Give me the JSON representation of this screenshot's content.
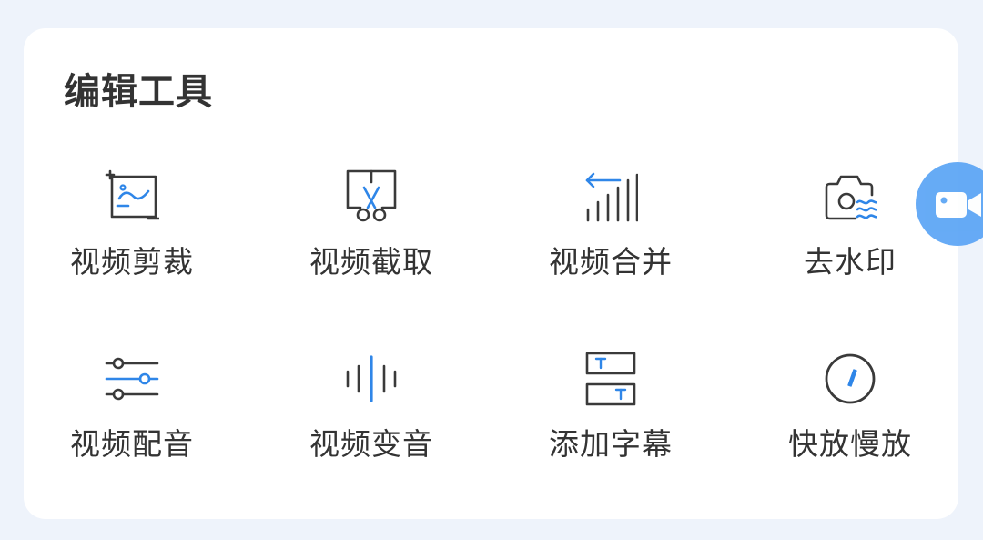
{
  "card": {
    "title": "编辑工具"
  },
  "tools": [
    {
      "label": "视频剪裁",
      "icon": "crop-image-icon"
    },
    {
      "label": "视频截取",
      "icon": "video-cut-scissors-icon"
    },
    {
      "label": "视频合并",
      "icon": "merge-bars-icon"
    },
    {
      "label": "去水印",
      "icon": "camera-watermark-icon"
    },
    {
      "label": "视频配音",
      "icon": "sliders-icon"
    },
    {
      "label": "视频变音",
      "icon": "voice-wave-icon"
    },
    {
      "label": "添加字幕",
      "icon": "subtitle-icon"
    },
    {
      "label": "快放慢放",
      "icon": "speed-dial-icon"
    }
  ],
  "floating_button": {
    "icon": "video-camera-icon"
  },
  "colors": {
    "accent": "#2f86e8",
    "icon_stroke": "#3a3a3a",
    "text": "#333333",
    "background": "#eef3fb",
    "card": "#ffffff",
    "floating_button": "#5aa4f5"
  }
}
